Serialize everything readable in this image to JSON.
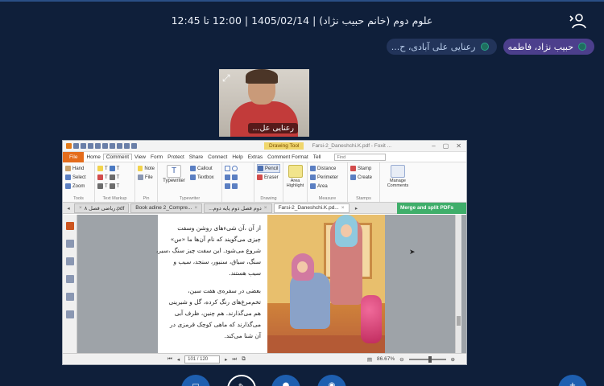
{
  "header": {
    "title": "علوم دوم (خانم حبیب نژاد) | 1405/02/14 | 12:00 تا 12:45",
    "user_icon": "user-icon"
  },
  "participants": [
    {
      "name": "حبیب نژاد، فاطمه",
      "status_color": "#2aa58a"
    },
    {
      "name": "رعنایی علی آبادی، ح...",
      "status_color": "#2aa58a"
    }
  ],
  "video": {
    "name": "رعنایی عل...",
    "expand_icon": "expand-icon"
  },
  "pdf_app": {
    "drawing_tool": "Drawing Tool",
    "doc_title": "Farsi-2_Daneshchi.K.pdf - Foxit ...",
    "menu": [
      "File",
      "Home",
      "Comment",
      "View",
      "Form",
      "Protect",
      "Share",
      "Connect",
      "Help",
      "Extras",
      "Comment Format"
    ],
    "active_menu": "Comment",
    "tell": "Tell",
    "search_placeholder": "Find",
    "ribbon": {
      "tools": {
        "items": [
          "Hand",
          "Select",
          "Zoom"
        ],
        "label": "Tools"
      },
      "text_markup": {
        "label": "Text Markup",
        "items": [
          "T",
          "T",
          "T",
          "T",
          "T",
          "T"
        ]
      },
      "pin": {
        "items": [
          "Note",
          "File"
        ],
        "label": "Pin"
      },
      "typewriter": {
        "big": "Typewriter",
        "items": [
          "Callout",
          "Textbox"
        ],
        "label": "Typewriter"
      },
      "drawing": {
        "items": [
          "Pencil",
          "Eraser"
        ],
        "label": "Drawing",
        "area_highlight": "Area Highlight"
      },
      "measure": {
        "items": [
          "Distance",
          "Perimeter",
          "Area"
        ],
        "label": "Measure"
      },
      "stamps": {
        "items": [
          "Stamp",
          "Create"
        ],
        "label": "Stamps"
      },
      "manage": {
        "label": "Manage Comments"
      }
    },
    "tabs": [
      {
        "label": "ریاضی فصل ۸.pdf",
        "active": false
      },
      {
        "label": "Book adine 2_Compre...",
        "active": false
      },
      {
        "label": "...دوم فصل دوم پایه دوم",
        "active": false
      },
      {
        "label": "Farsi-2_Daneshchi.K.pd...",
        "active": true
      }
    ],
    "promo": "Merge and split PDFs",
    "page_text": [
      "از آن ،آن شیءهای روشن وسفت",
      "چیزی می‌گویند که نام آن‌ها ما «س»",
      "شروع می‌شود. این سفت چیز سنگ ،سیر،",
      "سنگ، سیاق، سنبور، سنجد، سیب و",
      "سیب هستند.",
      "",
      "بعضی در سفره‌ی هفت سین،",
      "تخم‌مرغ‌های رنگ کرده، گل و شیرینی",
      "هم می‌گذارند. هم چنین، ظرف آبی",
      "می‌گذارند که ماهی کوچک قرمزی در",
      "آن شنا می‌کند."
    ],
    "status": {
      "page": "101 / 120",
      "zoom": "86.67%"
    }
  },
  "bottom_buttons": [
    "share-screen-button",
    "whiteboard-button",
    "microphone-button",
    "webcam-button",
    "more-button"
  ],
  "colors": {
    "background": "#0f1f3a",
    "chip_primary": "#4c3f8c",
    "chip_secondary": "#22345a",
    "accent": "#1e5fb0",
    "foxit_orange": "#e46c1c"
  }
}
